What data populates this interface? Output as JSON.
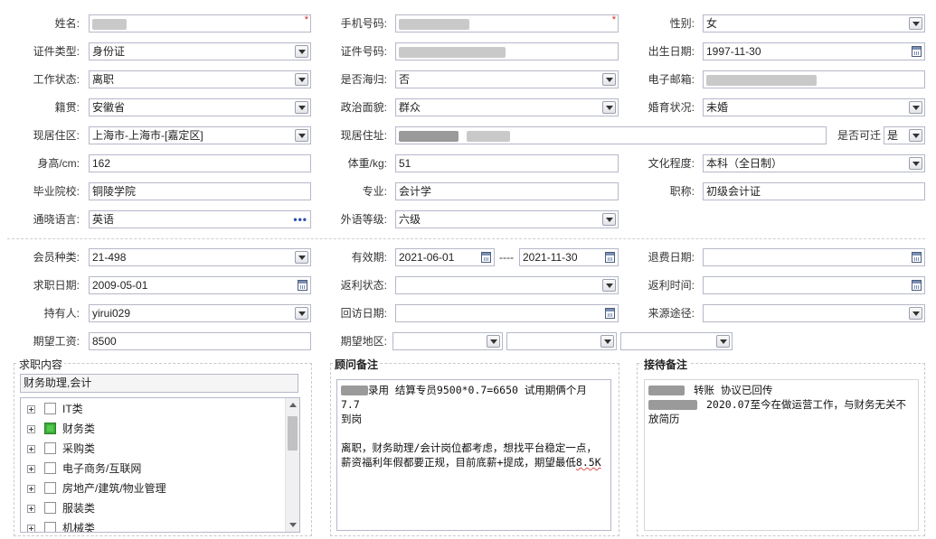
{
  "personal": {
    "name_label": "姓名:",
    "phone_label": "手机号码:",
    "gender_label": "性别:",
    "gender_value": "女",
    "id_type_label": "证件类型:",
    "id_type_value": "身份证",
    "id_no_label": "证件号码:",
    "birth_label": "出生日期:",
    "birth_value": "1997-11-30",
    "work_status_label": "工作状态:",
    "work_status_value": "离职",
    "overseas_label": "是否海归:",
    "overseas_value": "否",
    "email_label": "电子邮箱:",
    "native_label": "籍贯:",
    "native_value": "安徽省",
    "political_label": "政治面貌:",
    "political_value": "群众",
    "marital_label": "婚育状况:",
    "marital_value": "未婚",
    "residence_label": "现居住区:",
    "residence_value": "上海市-上海市-[嘉定区]",
    "address_label": "现居住址:",
    "relocate_label": "是否可迁",
    "relocate_value": "是",
    "height_label": "身高/cm:",
    "height_value": "162",
    "weight_label": "体重/kg:",
    "weight_value": "51",
    "education_label": "文化程度:",
    "education_value": "本科（全日制）",
    "school_label": "毕业院校:",
    "school_value": "铜陵学院",
    "major_label": "专业:",
    "major_value": "会计学",
    "title_label": "职称:",
    "title_value": "初级会计证",
    "language_label": "通晓语言:",
    "language_value": "英语",
    "foreign_level_label": "外语等级:",
    "foreign_level_value": "六级"
  },
  "membership": {
    "type_label": "会员种类:",
    "type_value": "21-498",
    "valid_label": "有效期:",
    "valid_from": "2021-06-01",
    "valid_sep": "----",
    "valid_to": "2021-11-30",
    "refund_date_label": "退费日期:",
    "job_date_label": "求职日期:",
    "job_date_value": "2009-05-01",
    "rebate_status_label": "返利状态:",
    "rebate_time_label": "返利时间:",
    "holder_label": "持有人:",
    "holder_value": "yirui029",
    "visit_date_label": "回访日期:",
    "source_label": "来源途径:",
    "salary_label": "期望工资:",
    "salary_value": "8500",
    "region_label": "期望地区:"
  },
  "job_content": {
    "title": "求职内容",
    "selected": "财务助理,会计",
    "categories": [
      {
        "label": "IT类",
        "checked": false
      },
      {
        "label": "财务类",
        "checked": true
      },
      {
        "label": "采购类",
        "checked": false
      },
      {
        "label": "电子商务/互联网",
        "checked": false
      },
      {
        "label": "房地产/建筑/物业管理",
        "checked": false
      },
      {
        "label": "服装类",
        "checked": false
      },
      {
        "label": "机械类",
        "checked": false
      }
    ]
  },
  "advisor_notes": {
    "title": "顾问备注",
    "line1": "录用 结算专员9500*0.7=6650  试用期俩个月  7.7",
    "line2": "到岗",
    "line3": "离职，财务助理/会计岗位都考虑，想找平台稳定一点，",
    "line4a": "薪资福利年假都要正规，目前底薪+提成，期望最低",
    "line4b": "8.5K"
  },
  "reception_notes": {
    "title": "接待备注",
    "line1": "转账  协议已回传",
    "line2": "2020.07至今在做运营工作，与财务无关不",
    "line3": "放简历"
  },
  "colors": {
    "required": "#e02020",
    "border": "#b5b8c8",
    "checked_green": "#3cad38"
  }
}
